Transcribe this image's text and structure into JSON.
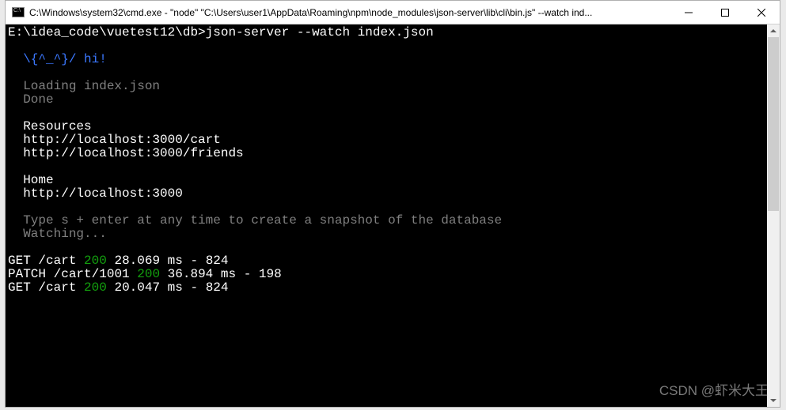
{
  "title": "C:\\Windows\\system32\\cmd.exe  -  \"node\"   \"C:\\Users\\user1\\AppData\\Roaming\\npm\\node_modules\\json-server\\lib\\cli\\bin.js\" --watch ind...",
  "prompt_path": "E:\\idea_code\\vuetest12\\db>",
  "command": "json-server --watch index.json",
  "hi_line": "  \\{^_^}/ hi!",
  "loading_line": "  Loading index.json",
  "done_line": "  Done",
  "resources_header": "  Resources",
  "resource_urls": [
    "  http://localhost:3000/cart",
    "  http://localhost:3000/friends"
  ],
  "home_header": "  Home",
  "home_url": "  http://localhost:3000",
  "tip_line": "  Type s + enter at any time to create a snapshot of the database",
  "watching_line": "  Watching...",
  "log": [
    {
      "method": "GET",
      "path": "/cart",
      "status": "200",
      "rest": "28.069 ms - 824"
    },
    {
      "method": "PATCH",
      "path": "/cart/1001",
      "status": "200",
      "rest": "36.894 ms - 198"
    },
    {
      "method": "GET",
      "path": "/cart",
      "status": "200",
      "rest": "20.047 ms - 824"
    }
  ],
  "watermark": "CSDN @虾米大王"
}
